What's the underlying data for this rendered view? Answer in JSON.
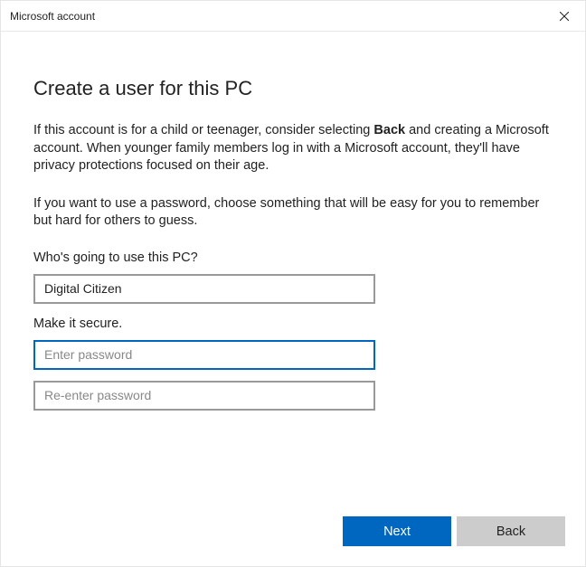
{
  "titlebar": {
    "title": "Microsoft account"
  },
  "heading": "Create a user for this PC",
  "paragraph1_pre": "If this account is for a child or teenager, consider selecting ",
  "paragraph1_bold": "Back",
  "paragraph1_post": " and creating a Microsoft account. When younger family members log in with a Microsoft account, they'll have privacy protections focused on their age.",
  "paragraph2": "If you want to use a password, choose something that will be easy for you to remember but hard for others to guess.",
  "label_user": "Who's going to use this PC?",
  "username_value": "Digital Citizen",
  "label_secure": "Make it secure.",
  "password_placeholder": "Enter password",
  "password_confirm_placeholder": "Re-enter password",
  "buttons": {
    "next": "Next",
    "back": "Back"
  }
}
